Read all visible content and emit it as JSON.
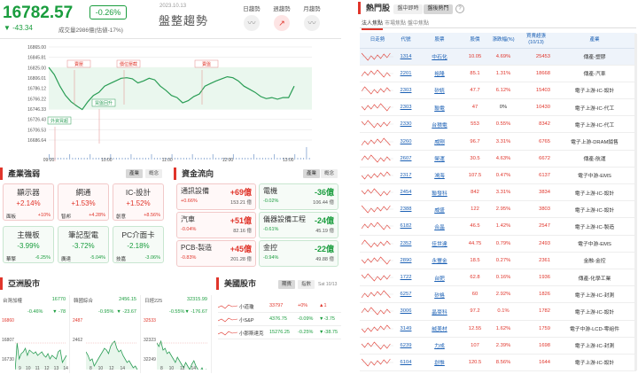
{
  "header": {
    "index_value": "16782.57",
    "index_pct": "-0.26%",
    "index_change": "▼ -43.34",
    "volume_text": "成交量2986億(估値-17%)",
    "date": "2023.10.13",
    "trend_label": "盤整趨勢",
    "trend_buttons": [
      {
        "label": "日趨勢",
        "icon": "chart-icon"
      },
      {
        "label": "週趨勢",
        "icon": "trend-up-icon"
      },
      {
        "label": "月趨勢",
        "icon": "chart-icon"
      }
    ]
  },
  "main_chart": {
    "y_ticks": [
      "16865.00",
      "16845.81",
      "16825.00",
      "16806.01",
      "16786.12",
      "16766.22",
      "16746.33",
      "16726.43",
      "16706.53",
      "16686.64"
    ],
    "x_ticks": [
      "09:00",
      "10:00",
      "11:00",
      "12:00",
      "13:00"
    ],
    "annotations": [
      "賣壓",
      "價位壓截",
      "賣盤",
      "買盤回升",
      "外資買超"
    ]
  },
  "chart_data": {
    "type": "line",
    "title": "",
    "xlabel": "",
    "ylabel": "",
    "x_range": [
      "09:00",
      "13:30"
    ],
    "ylim": [
      16686.64,
      16865.0
    ],
    "series": [
      {
        "values": [
          16826,
          16812,
          16790,
          16772,
          16760,
          16752,
          16745,
          16760,
          16772,
          16778,
          16790,
          16795,
          16800,
          16805,
          16806,
          16804,
          16796,
          16800,
          16805,
          16802,
          16790,
          16782,
          16772,
          16768,
          16758,
          16762,
          16770,
          16775,
          16790,
          16795,
          16800,
          16804,
          16808,
          16806,
          16800,
          16790,
          16784,
          16778,
          16770,
          16766,
          16768,
          16765,
          16768,
          16768,
          16790
        ]
      }
    ]
  },
  "industry": {
    "title": "產業強弱",
    "tabs": [
      "產業",
      "概念"
    ],
    "cards": [
      {
        "name": "顯示器",
        "pct": "+2.14%",
        "l": "面板",
        "r": "+10%",
        "dir": "up"
      },
      {
        "name": "網通",
        "pct": "+1.53%",
        "l": "智邦",
        "r": "+4.28%",
        "dir": "up"
      },
      {
        "name": "IC-設計",
        "pct": "+1.52%",
        "l": "創意",
        "r": "+8.56%",
        "dir": "up"
      },
      {
        "name": "主機板",
        "pct": "-3.99%",
        "l": "華擎",
        "r": "-6.25%",
        "dir": "dn"
      },
      {
        "name": "筆記型電",
        "pct": "-3.72%",
        "l": "廣達",
        "r": "-5.04%",
        "dir": "dn"
      },
      {
        "name": "PC介面卡",
        "pct": "-2.18%",
        "l": "技嘉",
        "r": "-3.06%",
        "dir": "dn"
      }
    ]
  },
  "money_flow": {
    "title": "資金流向",
    "tabs": [
      "產業",
      "概念"
    ],
    "items": [
      {
        "name": "通訊設備",
        "val": "+69億",
        "pct": "+0.66%",
        "total": "153.21 億",
        "dir": "up"
      },
      {
        "name": "電機",
        "val": "-36億",
        "pct": "-0.02%",
        "total": "106.44 億",
        "dir": "dn"
      },
      {
        "name": "汽車",
        "val": "+51億",
        "pct": "-0.04%",
        "total": "82.16 億",
        "dir": "up"
      },
      {
        "name": "儀器設備工程",
        "val": "-24億",
        "pct": "-0.61%",
        "total": "45.19 億",
        "dir": "dn"
      },
      {
        "name": "PCB-製造",
        "val": "+45億",
        "pct": "-0.83%",
        "total": "201.28 億",
        "dir": "up"
      },
      {
        "name": "金控",
        "val": "-22億",
        "pct": "-0.94%",
        "total": "49.88 億",
        "dir": "dn"
      }
    ]
  },
  "asia": {
    "title": "亞洲股市",
    "markets": [
      {
        "name": "台灣加權",
        "value": "16770",
        "pct": "-0.46%",
        "chg": "▼ -78",
        "ticks": [
          "16860",
          "16807",
          "16730"
        ]
      },
      {
        "name": "韓國綜合",
        "value": "2456.15",
        "pct": "-0.95%",
        "chg": "▼ -23.67",
        "ticks": [
          "2487",
          "2462"
        ]
      },
      {
        "name": "日經225",
        "value": "32315.99",
        "pct": "-0.55%",
        "chg": "▼ -176.67",
        "ticks": [
          "32533",
          "32323",
          "32249"
        ]
      }
    ],
    "x_ticks": [
      "9",
      "10",
      "11",
      "12",
      "13",
      "14"
    ]
  },
  "us": {
    "title": "美國股市",
    "tabs": [
      "期貨",
      "指數"
    ],
    "date": "Sat 10/13",
    "rows": [
      {
        "name": "小道瓊",
        "val": "33797",
        "chg": "+0%",
        "tail": "▲1",
        "dir": "up"
      },
      {
        "name": "小S&P",
        "val": "4376.75",
        "chg": "-0.09%",
        "tail": "▼-3.75",
        "dir": "dn"
      },
      {
        "name": "小那斯達克",
        "val": "15276.25",
        "chg": "-0.25%",
        "tail": "▼-38.75",
        "dir": "dn"
      }
    ]
  },
  "hot": {
    "title": "熱門股",
    "top_tabs": [
      "盤中即時",
      "盤後熱門"
    ],
    "sub_tabs": [
      "法人焦點",
      "市場焦點",
      "盤中焦點"
    ],
    "columns": [
      "日走勢",
      "代號",
      "股票",
      "股價",
      "漲跌幅(%)",
      "買賣超張\n(10/13)",
      "產業"
    ],
    "rows": [
      {
        "code": "1314",
        "name": "中石化",
        "price": "10.05",
        "pct": "4.69%",
        "vol": "25453",
        "ind": "傳產-塑膠",
        "selected": true
      },
      {
        "code": "2201",
        "name": "裕隆",
        "price": "85.1",
        "pct": "1.31%",
        "vol": "18668",
        "ind": "傳產-汽車"
      },
      {
        "code": "2303",
        "name": "矽統",
        "price": "47.7",
        "pct": "6.12%",
        "vol": "15403",
        "ind": "電子上游-IC-設計"
      },
      {
        "code": "2303",
        "name": "聯電",
        "price": "47",
        "pct": "0%",
        "vol": "10430",
        "ind": "電子上游-IC-代工"
      },
      {
        "code": "2330",
        "name": "台積電",
        "price": "553",
        "pct": "0.55%",
        "vol": "8342",
        "ind": "電子上游-IC-代工"
      },
      {
        "code": "3260",
        "name": "威剛",
        "price": "96.7",
        "pct": "3.31%",
        "vol": "6765",
        "ind": "電子上游-DRAM銷售"
      },
      {
        "code": "2607",
        "name": "榮運",
        "price": "30.5",
        "pct": "4.63%",
        "vol": "6672",
        "ind": "傳產-航運"
      },
      {
        "code": "2317",
        "name": "鴻海",
        "price": "107.5",
        "pct": "0.47%",
        "vol": "6137",
        "ind": "電子中游-EMS"
      },
      {
        "code": "2454",
        "name": "聯發科",
        "price": "842",
        "pct": "3.31%",
        "vol": "3834",
        "ind": "電子上游-IC-設計"
      },
      {
        "code": "2388",
        "name": "威盛",
        "price": "122",
        "pct": "2.95%",
        "vol": "3803",
        "ind": "電子上游-IC-設計"
      },
      {
        "code": "6182",
        "name": "合晶",
        "price": "46.5",
        "pct": "1.42%",
        "vol": "2547",
        "ind": "電子上游-IC-製造"
      },
      {
        "code": "2352",
        "name": "佳世達",
        "price": "44.75",
        "pct": "0.79%",
        "vol": "2493",
        "ind": "電子中游-EMS"
      },
      {
        "code": "2890",
        "name": "永豐金",
        "price": "18.5",
        "pct": "0.27%",
        "vol": "2361",
        "ind": "金融-金控"
      },
      {
        "code": "1722",
        "name": "台肥",
        "price": "62.8",
        "pct": "0.16%",
        "vol": "1936",
        "ind": "傳產-化學工業"
      },
      {
        "code": "6257",
        "name": "矽格",
        "price": "60",
        "pct": "2.92%",
        "vol": "1826",
        "ind": "電子上游-IC-封測"
      },
      {
        "code": "3006",
        "name": "晶豪科",
        "price": "97.2",
        "pct": "0.1%",
        "vol": "1782",
        "ind": "電子上游-IC-設計"
      },
      {
        "code": "3149",
        "name": "誠美材",
        "price": "12.55",
        "pct": "1.62%",
        "vol": "1759",
        "ind": "電子中游-LCD-零組件"
      },
      {
        "code": "6239",
        "name": "力成",
        "price": "107",
        "pct": "2.39%",
        "vol": "1698",
        "ind": "電子上游-IC-封測"
      },
      {
        "code": "6104",
        "name": "創惟",
        "price": "120.5",
        "pct": "8.56%",
        "vol": "1644",
        "ind": "電子上游-IC-設計"
      }
    ]
  }
}
